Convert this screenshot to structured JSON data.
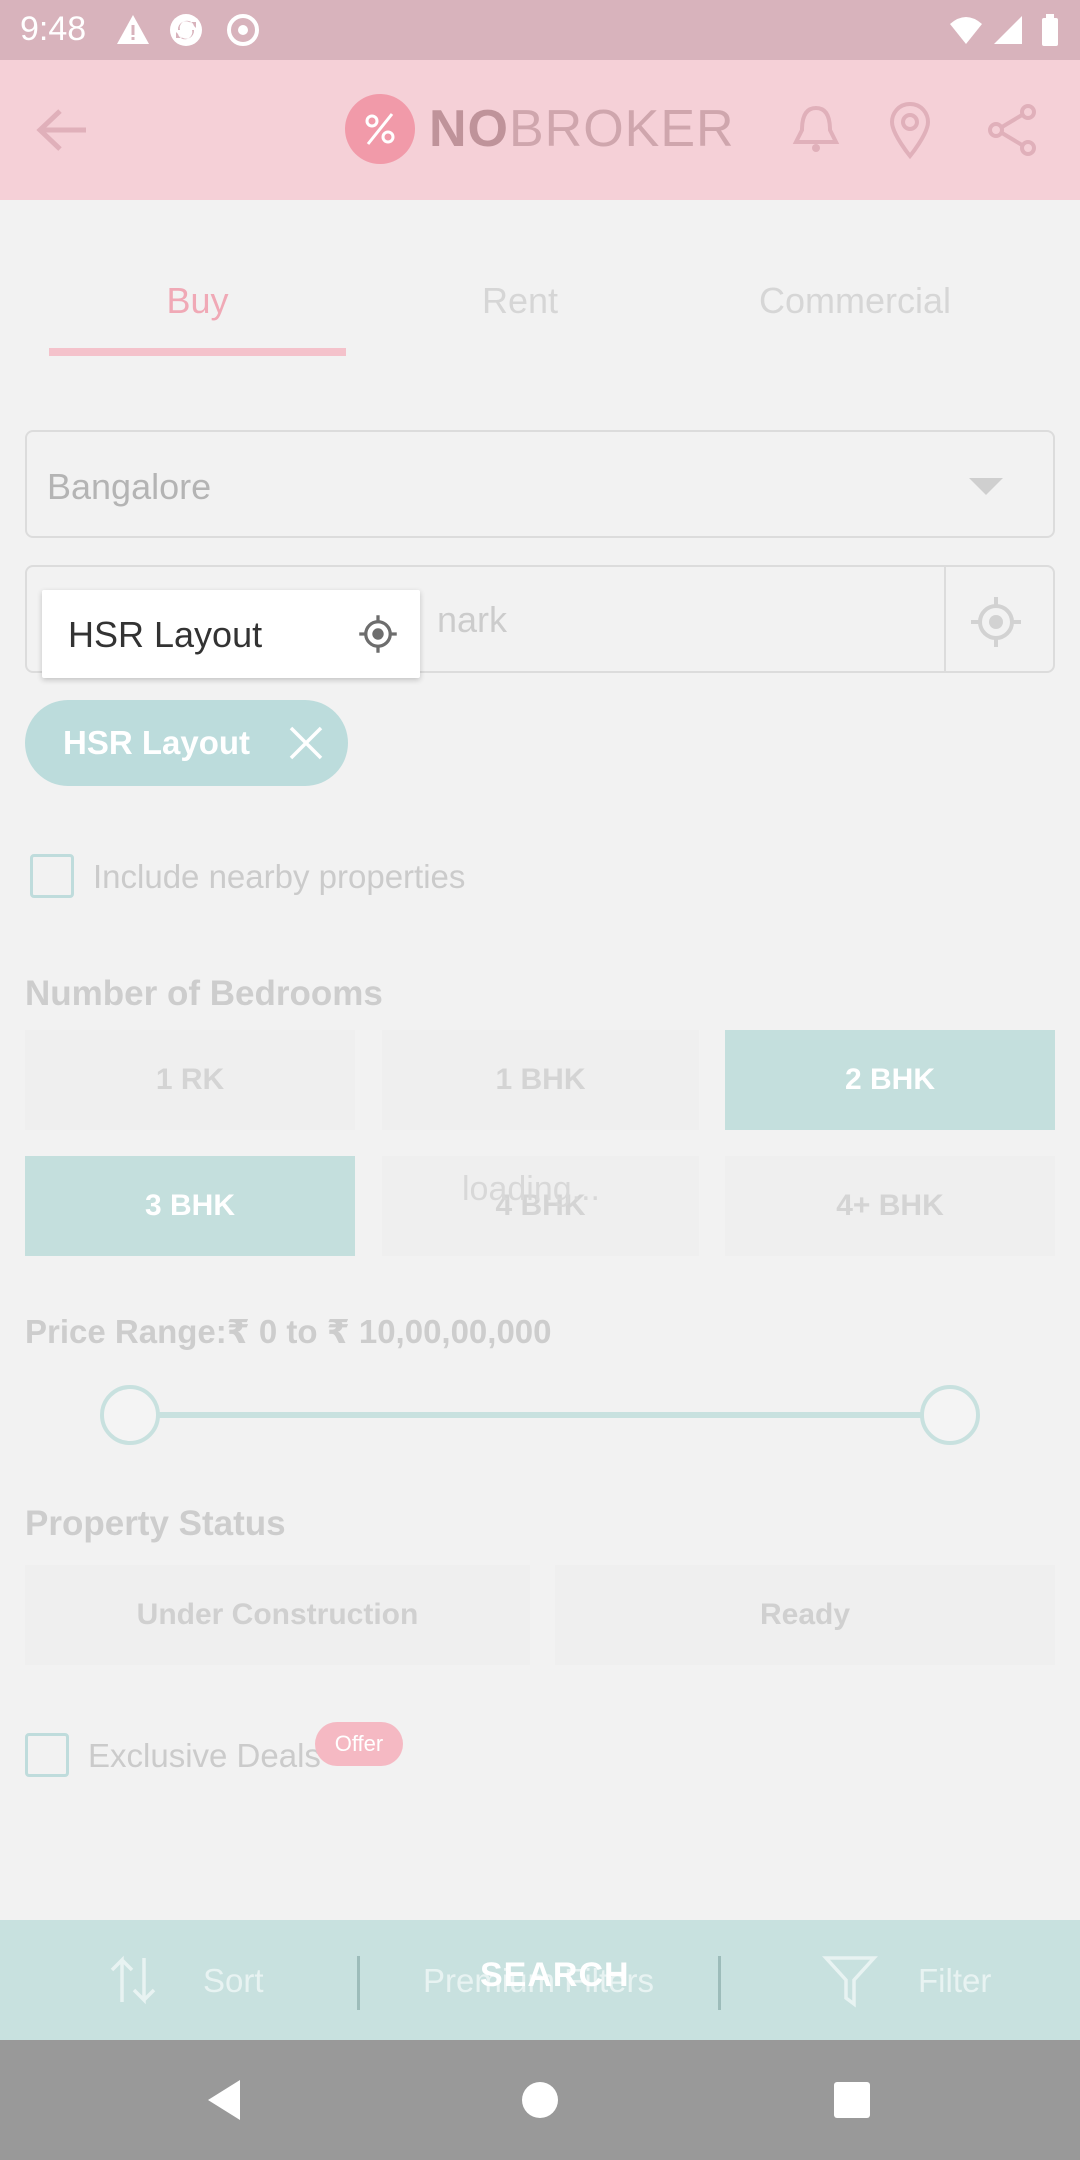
{
  "status_bar": {
    "time": "9:48"
  },
  "header": {
    "logo_bold": "NO",
    "logo_rest": "BROKER"
  },
  "tabs": [
    {
      "label": "Buy",
      "active": true
    },
    {
      "label": "Rent",
      "active": false
    },
    {
      "label": "Commercial",
      "active": false
    }
  ],
  "city_select": {
    "value": "Bangalore"
  },
  "locality_search": {
    "placeholder_visible": "nark"
  },
  "suggestion": {
    "text": "HSR Layout"
  },
  "chip": {
    "label": "HSR Layout"
  },
  "nearby": {
    "label": "Include nearby properties",
    "checked": false
  },
  "bedrooms": {
    "title": "Number of Bedrooms",
    "options": [
      {
        "label": "1 RK",
        "selected": false
      },
      {
        "label": "1 BHK",
        "selected": false
      },
      {
        "label": "2 BHK",
        "selected": true
      },
      {
        "label": "3 BHK",
        "selected": true
      },
      {
        "label": "4 BHK",
        "selected": false
      },
      {
        "label": "4+ BHK",
        "selected": false
      }
    ],
    "loading": "loading..."
  },
  "price": {
    "label": "Price Range:₹ 0   to   ₹ 10,00,00,000"
  },
  "property_status": {
    "title": "Property Status",
    "options": [
      "Under Construction",
      "Ready"
    ]
  },
  "exclusive": {
    "label": "Exclusive Deals",
    "badge": "Offer",
    "checked": false
  },
  "bottom_bar": {
    "sort": "Sort",
    "premium": "Premium Filters",
    "filter": "Filter",
    "search": "SEARCH"
  },
  "colors": {
    "brand_pink": "#f19aa9",
    "teal": "#c4dfdd"
  }
}
